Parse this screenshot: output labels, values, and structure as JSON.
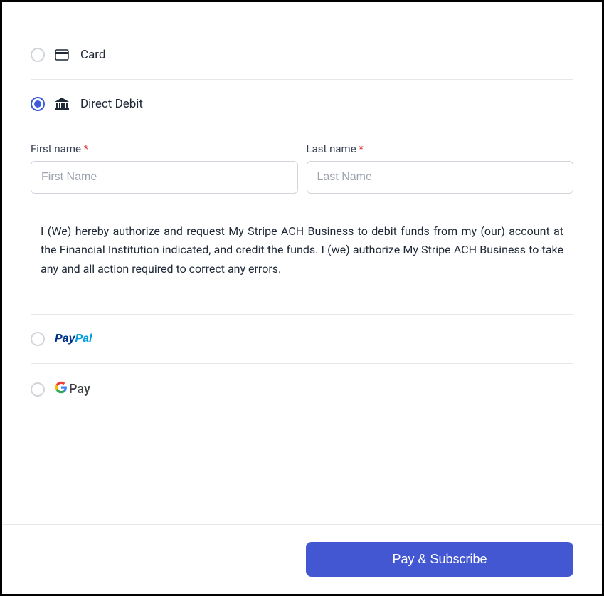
{
  "paymentOptions": {
    "card": {
      "label": "Card"
    },
    "directDebit": {
      "label": "Direct Debit"
    },
    "paypal": {
      "part1": "Pay",
      "part2": "Pal"
    },
    "gpay": {
      "label": "Pay"
    }
  },
  "form": {
    "firstName": {
      "label": "First name ",
      "required": "*",
      "placeholder": "First Name"
    },
    "lastName": {
      "label": "Last name ",
      "required": "*",
      "placeholder": "Last Name"
    },
    "authorization": "I (We) hereby authorize and request My Stripe ACH Business to debit funds from my (our) account at the Financial Institution indicated, and credit the funds. I (we) authorize My Stripe ACH Business to take any and all action required to correct any errors."
  },
  "footer": {
    "submitLabel": "Pay & Subscribe"
  }
}
